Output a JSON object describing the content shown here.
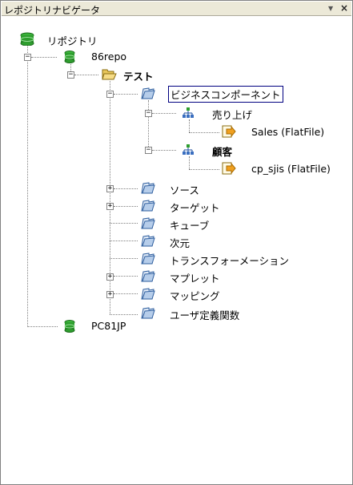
{
  "panel": {
    "title": "レポジトリナビゲータ",
    "pin_glyph": "▼",
    "close_glyph": "×"
  },
  "tree": {
    "root": {
      "label": "リポジトリ",
      "icon": "database-icon"
    },
    "repo86": {
      "label": "86repo",
      "icon": "database-icon",
      "expanded": true
    },
    "test": {
      "label": "テスト",
      "icon": "open-folder-icon",
      "expanded": true
    },
    "business": {
      "label": "ビジネスコンポーネント",
      "icon": "folder-icon",
      "selected": true,
      "expanded": true
    },
    "sales_group": {
      "label": "売り上げ",
      "icon": "hierarchy-icon",
      "expanded": true
    },
    "sales_file": {
      "label": "Sales (FlatFile)",
      "icon": "source-arrow-icon"
    },
    "customer_group": {
      "label": "顧客",
      "icon": "hierarchy-icon",
      "expanded": true
    },
    "customer_file": {
      "label": "cp_sjis (FlatFile)",
      "icon": "source-arrow-icon"
    },
    "source": {
      "label": "ソース",
      "icon": "folder-icon",
      "expandable": true
    },
    "target": {
      "label": "ターゲット",
      "icon": "folder-icon",
      "expandable": true
    },
    "cube": {
      "label": "キューブ",
      "icon": "folder-icon"
    },
    "dimension": {
      "label": "次元",
      "icon": "folder-icon"
    },
    "transformation": {
      "label": "トランスフォーメーション",
      "icon": "folder-icon"
    },
    "mapplet": {
      "label": "マプレット",
      "icon": "folder-icon",
      "expandable": true
    },
    "mapping": {
      "label": "マッピング",
      "icon": "folder-icon",
      "expandable": true
    },
    "udf": {
      "label": "ユーザ定義関数",
      "icon": "folder-icon"
    },
    "pc81": {
      "label": "PC81JP",
      "icon": "database-icon"
    }
  },
  "expander": {
    "expanded": "−",
    "collapsed": "+"
  },
  "colors": {
    "db_green": "#2e9e2e",
    "folder_blue": "#4a7fc1",
    "folder_yellow": "#c9a227",
    "arrow_orange": "#f0a020",
    "selection_border": "#000080"
  }
}
